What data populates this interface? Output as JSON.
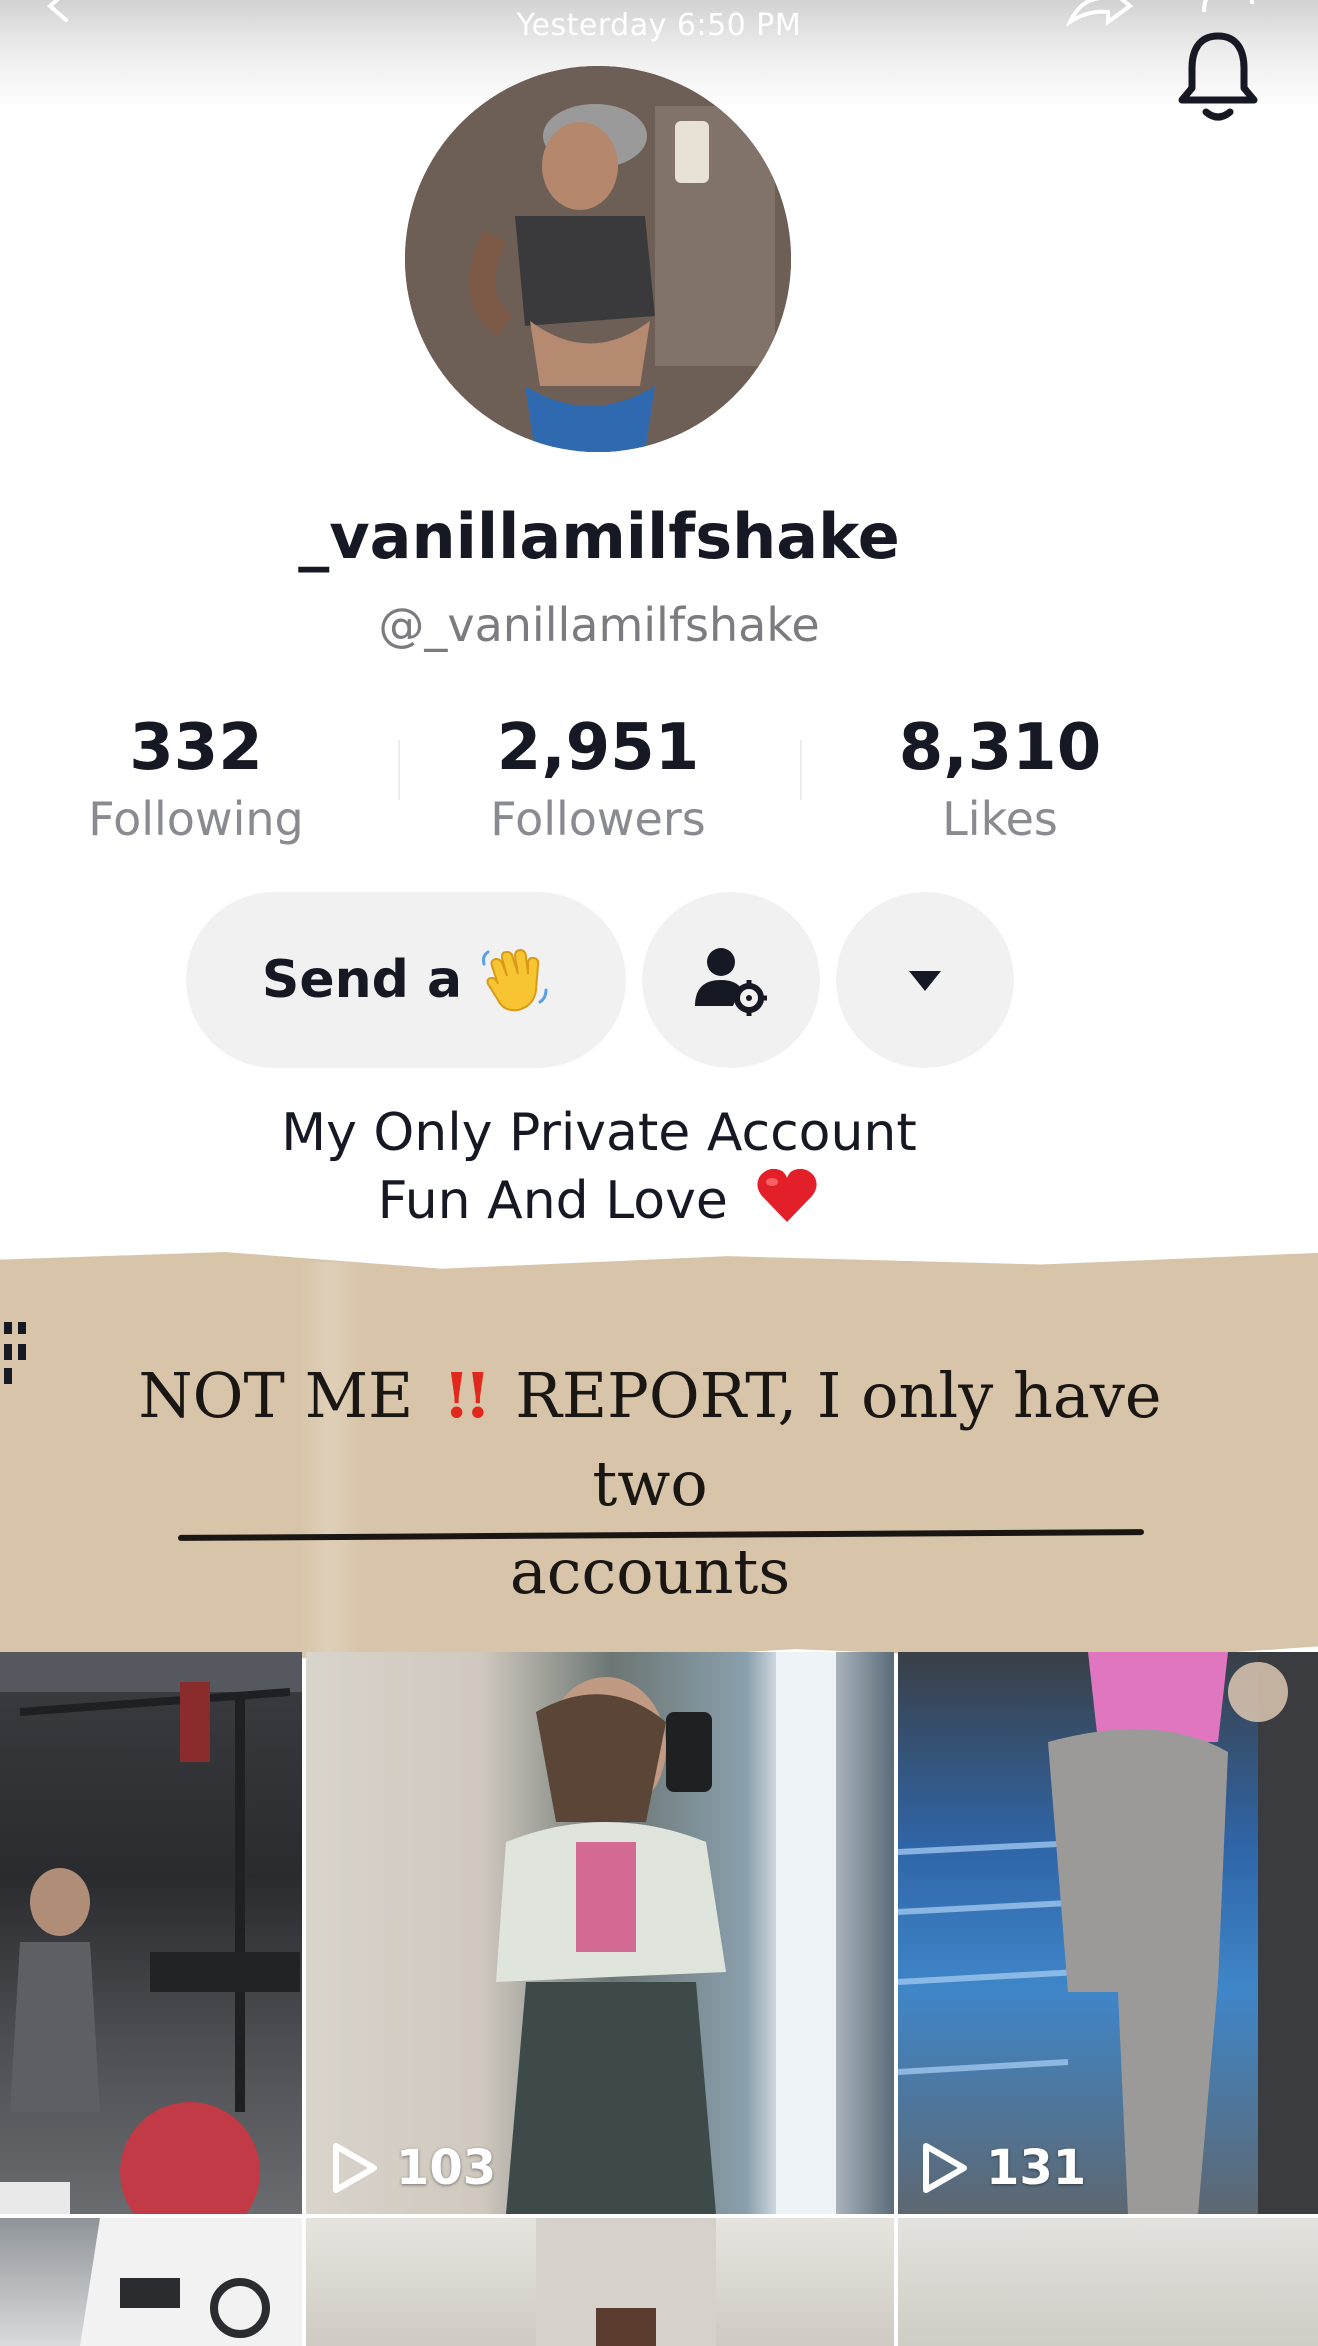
{
  "header": {
    "timestamp": "Yesterday 6:50 PM",
    "icons": [
      "back-icon",
      "share-icon",
      "more-icon",
      "bell-icon"
    ]
  },
  "profile": {
    "display_name": "_vanillamilfshake",
    "handle": "@_vanillamilfshake",
    "stats": [
      {
        "value": "332",
        "label": "Following"
      },
      {
        "value": "2,951",
        "label": "Followers"
      },
      {
        "value": "8,310",
        "label": "Likes"
      }
    ],
    "send_button": "Send a",
    "bio_line1": "My Only Private Account",
    "bio_line2": "Fun And Love"
  },
  "note": {
    "part1": "NOT ME",
    "part2": "REPORT, I only have two",
    "part3": "accounts"
  },
  "videos": [
    {
      "views": ""
    },
    {
      "views": "103"
    },
    {
      "views": "131"
    }
  ],
  "colors": {
    "paper": "#d8c5a9",
    "button_bg": "#f1f1f2",
    "secondary_text": "#8a8b91",
    "alert_red": "#e0281c"
  }
}
